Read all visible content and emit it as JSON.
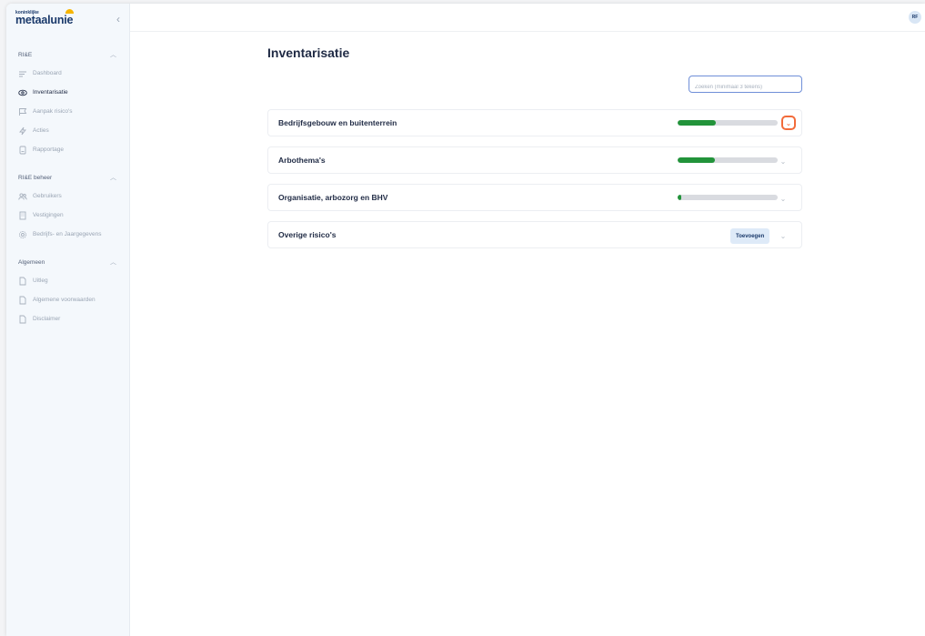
{
  "sidebar": {
    "logo_small": "koninklijke",
    "logo_big": "metaalunie",
    "collapse_icon": "chevron-left-icon",
    "sections": [
      {
        "title": "RI&E",
        "items": [
          {
            "label": "Dashboard",
            "icon": "list-icon"
          },
          {
            "label": "Inventarisatie",
            "icon": "eye-icon",
            "active": true
          },
          {
            "label": "Aanpak risico's",
            "icon": "flag-icon"
          },
          {
            "label": "Acties",
            "icon": "lightning-icon"
          },
          {
            "label": "Rapportage",
            "icon": "report-icon"
          }
        ]
      },
      {
        "title": "RI&E beheer",
        "items": [
          {
            "label": "Gebruikers",
            "icon": "users-icon"
          },
          {
            "label": "Vestigingen",
            "icon": "building-icon"
          },
          {
            "label": "Bedrijfs- en Jaargegevens",
            "icon": "gear-icon"
          }
        ]
      },
      {
        "title": "Algemeen",
        "items": [
          {
            "label": "Uitleg",
            "icon": "document-icon"
          },
          {
            "label": "Algemene voorwaarden",
            "icon": "document-icon"
          },
          {
            "label": "Disclaimer",
            "icon": "document-icon"
          }
        ]
      }
    ]
  },
  "topbar": {
    "avatar_initials": "RF"
  },
  "main": {
    "title": "Inventarisatie",
    "search": {
      "placeholder": "Zoeken (minimaal 3 tekens)",
      "value": ""
    },
    "rows": [
      {
        "title": "Bedrijfsgebouw en buitenterrein",
        "progress_percent": 38,
        "highlighted": true
      },
      {
        "title": "Arbothema's",
        "progress_percent": 37
      },
      {
        "title": "Organisatie, arbozorg en BHV",
        "progress_percent": 4
      },
      {
        "title": "Overige risico's",
        "button_label": "Toevoegen"
      }
    ]
  },
  "colors": {
    "progress_fill": "#22933a",
    "progress_track": "#d9dbe0",
    "highlight": "#f26b3a",
    "accent_border": "#6f8fd8"
  }
}
